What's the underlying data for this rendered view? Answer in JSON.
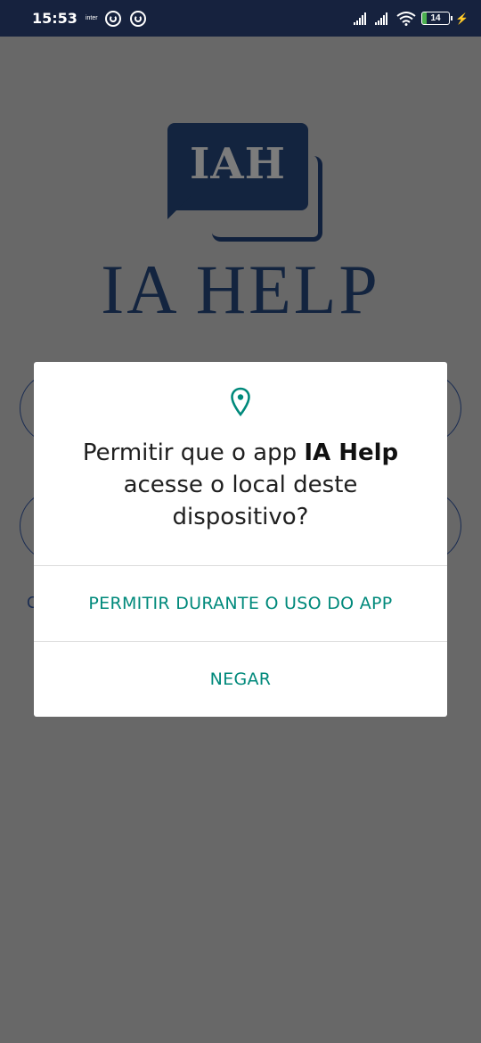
{
  "status_bar": {
    "time": "15:53",
    "carrier": "inter",
    "battery_level": "14",
    "icons": [
      "app-notification-icon",
      "app-notification-icon",
      "signal-icon",
      "signal-icon",
      "wifi-icon",
      "battery-icon",
      "charging-icon"
    ]
  },
  "app": {
    "logo_mark": "IAH",
    "logo_text": "IA HELP",
    "partial_link": "C",
    "colors": {
      "brand": "#13243f",
      "overlay": "#686868"
    }
  },
  "dialog": {
    "icon": "location-pin-icon",
    "message_prefix": "Permitir que o app ",
    "app_name": "IA Help",
    "message_suffix": " acesse o local deste dispositivo?",
    "allow_label": "PERMITIR DURANTE O USO DO APP",
    "deny_label": "NEGAR",
    "accent_color": "#00897b"
  }
}
